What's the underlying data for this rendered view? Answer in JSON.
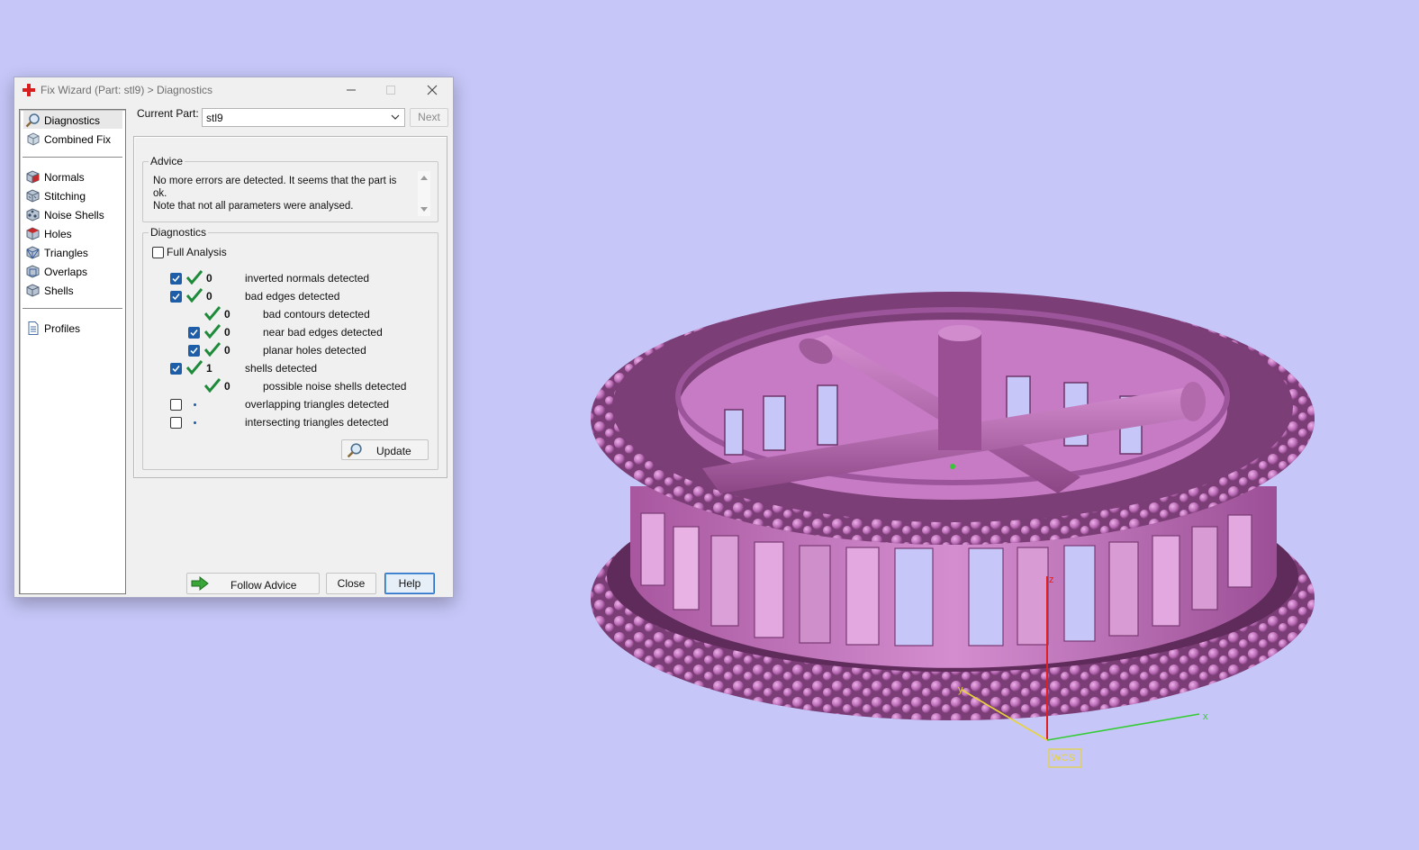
{
  "window": {
    "title": "Fix Wizard (Part: stl9) > Diagnostics"
  },
  "nav": {
    "items": [
      {
        "label": "Diagnostics",
        "icon": "magnifier-icon",
        "selected": true
      },
      {
        "label": "Combined Fix",
        "icon": "combined-fix-icon"
      },
      {
        "label": "Normals",
        "icon": "normals-cube-icon"
      },
      {
        "label": "Stitching",
        "icon": "stitching-cube-icon"
      },
      {
        "label": "Noise Shells",
        "icon": "noise-shells-cube-icon"
      },
      {
        "label": "Holes",
        "icon": "holes-cube-icon"
      },
      {
        "label": "Triangles",
        "icon": "triangles-cube-icon"
      },
      {
        "label": "Overlaps",
        "icon": "overlaps-cube-icon"
      },
      {
        "label": "Shells",
        "icon": "shells-cube-icon"
      },
      {
        "label": "Profiles",
        "icon": "document-icon"
      }
    ]
  },
  "current_part": {
    "label": "Current Part:",
    "value": "stl9",
    "next_label": "Next"
  },
  "advice": {
    "group_label": "Advice",
    "line1": "No more errors are detected. It seems that the part is ok.",
    "line2": "Note that not all parameters were analysed."
  },
  "diagnostics": {
    "group_label": "Diagnostics",
    "full_analysis_label": "Full Analysis",
    "full_analysis_checked": false,
    "rows": [
      {
        "checkbox": true,
        "checked": true,
        "status": "ok",
        "count": "0",
        "label": "inverted normals detected"
      },
      {
        "checkbox": true,
        "checked": true,
        "status": "ok",
        "count": "0",
        "label": "bad edges detected"
      },
      {
        "checkbox": false,
        "status": "ok",
        "count": "0",
        "label": "bad contours detected"
      },
      {
        "checkbox": true,
        "checked": true,
        "status": "ok",
        "count": "0",
        "label": "near bad edges detected"
      },
      {
        "checkbox": true,
        "checked": true,
        "status": "ok",
        "count": "0",
        "label": "planar holes detected"
      },
      {
        "checkbox": true,
        "checked": true,
        "status": "ok",
        "count": "1",
        "label": "shells detected"
      },
      {
        "checkbox": false,
        "status": "ok",
        "count": "0",
        "label": "possible noise shells detected"
      },
      {
        "checkbox": true,
        "checked": false,
        "status": "pending",
        "count": "",
        "label": "overlapping triangles detected"
      },
      {
        "checkbox": true,
        "checked": false,
        "status": "pending",
        "count": "",
        "label": "intersecting triangles detected"
      }
    ],
    "update_label": "Update"
  },
  "footer": {
    "follow_advice_label": "Follow Advice",
    "close_label": "Close",
    "help_label": "Help"
  },
  "viewport": {
    "model_color": "#c77bc4",
    "axis_z": "z",
    "axis_x": "x",
    "axis_y": "y",
    "wcs_label": "WCS"
  },
  "colors": {
    "background": "#c6c6f8",
    "check_green": "#1f8a3a",
    "checkbox_blue": "#1e5ea8"
  }
}
